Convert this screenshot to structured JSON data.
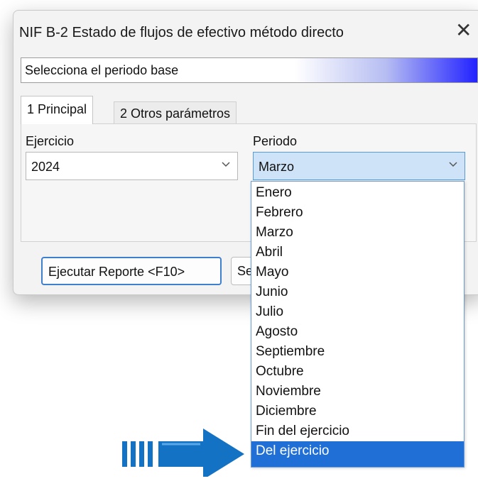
{
  "dialog": {
    "title": "NIF B-2 Estado de flujos de efectivo método directo",
    "close_symbol": "✕",
    "hint": "Selecciona el periodo base"
  },
  "tabs": [
    {
      "label": "1 Principal",
      "active": true
    },
    {
      "label": "2 Otros parámetros",
      "active": false
    }
  ],
  "form": {
    "ejercicio_label": "Ejercicio",
    "ejercicio_value": "2024",
    "periodo_label": "Periodo",
    "periodo_value": "Marzo"
  },
  "buttons": {
    "run_label": "Ejecutar Reporte <F10>",
    "second_label": "Se"
  },
  "dropdown": {
    "options": [
      "Enero",
      "Febrero",
      "Marzo",
      "Abril",
      "Mayo",
      "Junio",
      "Julio",
      "Agosto",
      "Septiembre",
      "Octubre",
      "Noviembre",
      "Diciembre",
      "Fin del ejercicio",
      "Del ejercicio"
    ],
    "highlighted": "Del ejercicio"
  },
  "colors": {
    "accent": "#1f6fd6",
    "arrow": "#1472c4",
    "focus_bg": "#cfe3f8"
  },
  "icons": {
    "chevron": "chevron-down-icon",
    "pointer": "right-arrow-icon",
    "close": "close-icon"
  }
}
